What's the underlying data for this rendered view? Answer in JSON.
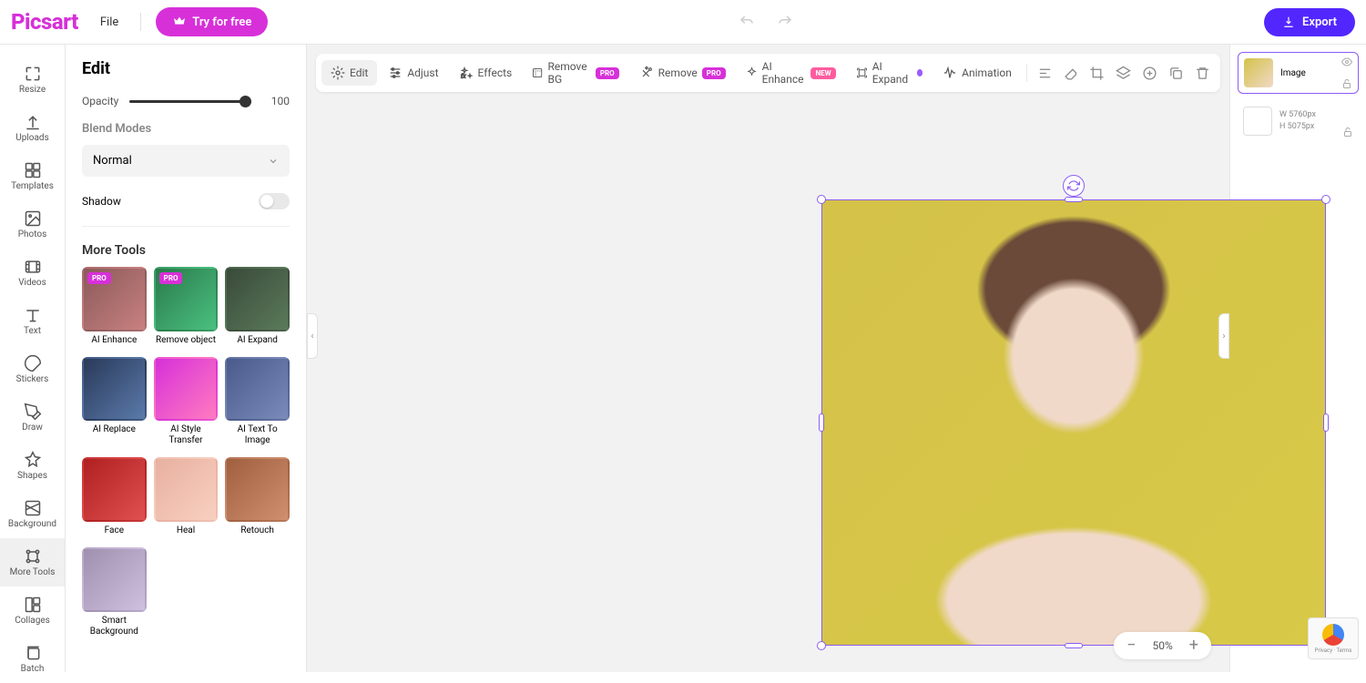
{
  "header": {
    "logo": "Picsart",
    "file": "File",
    "try_free": "Try for free",
    "export": "Export"
  },
  "rail": [
    {
      "id": "resize",
      "label": "Resize"
    },
    {
      "id": "uploads",
      "label": "Uploads"
    },
    {
      "id": "templates",
      "label": "Templates"
    },
    {
      "id": "photos",
      "label": "Photos"
    },
    {
      "id": "videos",
      "label": "Videos"
    },
    {
      "id": "text",
      "label": "Text"
    },
    {
      "id": "stickers",
      "label": "Stickers"
    },
    {
      "id": "draw",
      "label": "Draw"
    },
    {
      "id": "shapes",
      "label": "Shapes"
    },
    {
      "id": "background",
      "label": "Background"
    },
    {
      "id": "more-tools",
      "label": "More Tools"
    },
    {
      "id": "collages",
      "label": "Collages"
    },
    {
      "id": "batch",
      "label": "Batch"
    }
  ],
  "panel": {
    "title": "Edit",
    "opacity_label": "Opacity",
    "opacity_value": "100",
    "blend_title": "Blend Modes",
    "blend_value": "Normal",
    "shadow_label": "Shadow",
    "more_tools": "More Tools"
  },
  "tools": [
    {
      "label": "AI Enhance",
      "badge": "PRO",
      "bg": "linear-gradient(135deg,#8b5a5a,#c98080)"
    },
    {
      "label": "Remove object",
      "badge": "PRO",
      "bg": "linear-gradient(135deg,#2a7a4a,#4ac080)"
    },
    {
      "label": "AI Expand",
      "badge": "",
      "bg": "linear-gradient(135deg,#3a4a3a,#5a7a5a)"
    },
    {
      "label": "AI Replace",
      "badge": "",
      "bg": "linear-gradient(135deg,#2a3a5a,#5a7aaa)"
    },
    {
      "label": "AI Style Transfer",
      "badge": "",
      "bg": "linear-gradient(135deg,#d730d9,#ff7bc0)"
    },
    {
      "label": "AI Text To Image",
      "badge": "",
      "bg": "linear-gradient(135deg,#4a5a8a,#7a8aba)"
    },
    {
      "label": "Face",
      "badge": "",
      "bg": "linear-gradient(135deg,#b02020,#e05050)"
    },
    {
      "label": "Heal",
      "badge": "",
      "bg": "linear-gradient(135deg,#e8b0a0,#f8d0c0)"
    },
    {
      "label": "Retouch",
      "badge": "",
      "bg": "linear-gradient(135deg,#a06040,#d09070)"
    },
    {
      "label": "Smart Background",
      "badge": "",
      "bg": "linear-gradient(135deg,#a090b0,#d0c0e0)"
    }
  ],
  "toolbar": [
    {
      "id": "edit",
      "label": "Edit",
      "active": true
    },
    {
      "id": "adjust",
      "label": "Adjust"
    },
    {
      "id": "effects",
      "label": "Effects"
    },
    {
      "id": "remove-bg",
      "label": "Remove BG",
      "badge": "PRO",
      "badgeClass": "pro"
    },
    {
      "id": "remove",
      "label": "Remove",
      "badge": "PRO",
      "badgeClass": "pro"
    },
    {
      "id": "ai-enhance",
      "label": "AI Enhance",
      "badge": "NEW",
      "badgeClass": "new"
    },
    {
      "id": "ai-expand",
      "label": "AI Expand",
      "badge": "●",
      "badgeClass": "dot"
    },
    {
      "id": "animation",
      "label": "Animation"
    }
  ],
  "layers": {
    "image_label": "Image",
    "width": "W  5760px",
    "height": "H  5075px"
  },
  "zoom": "50%",
  "recaptcha": "Privacy · Terms"
}
